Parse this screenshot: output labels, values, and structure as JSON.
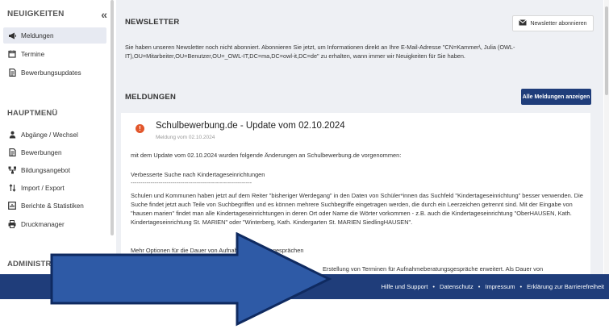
{
  "sidebar": {
    "header": "NEUIGKEITEN",
    "collapse_glyph": "«",
    "news_items": [
      {
        "label": "Meldungen",
        "icon": "megaphone-icon",
        "active": true
      },
      {
        "label": "Termine",
        "icon": "calendar-icon",
        "active": false
      },
      {
        "label": "Bewerbungsupdates",
        "icon": "document-icon",
        "active": false
      }
    ],
    "main_section": "HAUPTMENÜ",
    "main_items": [
      {
        "label": "Abgänge / Wechsel",
        "icon": "person-icon"
      },
      {
        "label": "Bewerbungen",
        "icon": "document-icon"
      },
      {
        "label": "Bildungsangebot",
        "icon": "sitemap-icon"
      },
      {
        "label": "Import / Export",
        "icon": "arrows-updown-icon"
      },
      {
        "label": "Berichte & Statistiken",
        "icon": "report-icon"
      },
      {
        "label": "Druckmanager",
        "icon": "printer-icon"
      }
    ],
    "admin_section": "ADMINISTRATION"
  },
  "newsletter": {
    "title": "NEWSLETTER",
    "subscribe_button": "Newsletter abonnieren",
    "text": "Sie haben unseren Newsletter noch nicht abonniert. Abonnieren Sie jetzt, um Informationen direkt an Ihre E-Mail-Adresse \"CN=Kammer\\, Julia (OWL-IT),OU=Mitarbeiter,OU=Benutzer,OU=_OWL-IT,DC=ma,DC=owl-it,DC=de\" zu erhalten, wann immer wir Neuigkeiten für Sie haben."
  },
  "news": {
    "title": "MELDUNGEN",
    "all_button": "Alle Meldungen anzeigen",
    "message": {
      "title": "Schulbewerbung.de - Update vom 02.10.2024",
      "date": "Meldung vom 02.10.2024",
      "intro": "mit dem Update vom 02.10.2024 wurden folgende Änderungen an Schulbewerbung.de vorgenommen:",
      "section1_title": "Verbesserte Suche nach Kindertageseinrichtungen",
      "divider": "-------------------------------------------------------------",
      "section1_text": "Schulen und Kommunen haben jetzt auf dem Reiter \"bisheriger Werdegang\" in den Daten von Schüler*innen das Suchfeld \"Kindertageseinrichtung\" besser verwenden. Die Suche findet jetzt auch Teile von Suchbegriffen und es können mehrere Suchbegriffe eingetragen werden, die durch ein Leerzeichen getrennt sind. Mit der Eingabe von \"hausen marien\" findet man alle Kindertageseinrichtungen in deren Ort oder Name die Wörter vorkommen - z.B. auch die Kindertageseinrichtung \"OberHAUSEN, Kath. Kindertageseinrichtung St. MARIEN\" oder \"Winterberg, Kath. Kindergarten St. MARIEN SiedlingHAUSEN\".",
      "section2_title": "Mehr Optionen für die Dauer von Aufnahmeberatungsgesprächen",
      "divider2": "-------------------------------------------------------------",
      "section2_text_partial": "Erstellung von Terminen für Aufnahmeberatungsgespräche erweitert. Als Dauer von"
    }
  },
  "footer": {
    "links": [
      "Hilfe und Support",
      "Datenschutz",
      "Impressum",
      "Erklärung zur Barrierefreiheit"
    ],
    "separator": "•"
  },
  "colors": {
    "footer_bg": "#1f3d7a",
    "button_dark": "#1f3d7a",
    "arrow_fill": "#2e5aa6",
    "arrow_stroke": "#0f2a60",
    "info_icon": "#e2562b"
  }
}
